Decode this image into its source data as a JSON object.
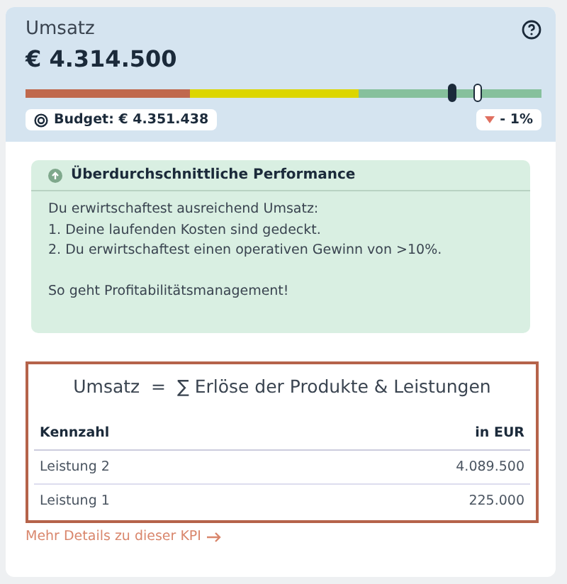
{
  "kpi": {
    "title": "Umsatz",
    "value": "€ 4.314.500",
    "actual_marker": {
      "level": 0.826
    },
    "budget_marker": {
      "level": 0.875
    },
    "budget": "Budget: € 4.351.438",
    "delta": {
      "text": "- 1%",
      "negative": true
    }
  },
  "assessment": {
    "title": "Überdurchschnittliche Performance",
    "paragraphs": [
      [
        "Du erwirtschaftest ausreichend Umsatz:",
        "1. Deine laufenden Kosten sind gedeckt.",
        "2. Du erwirtschaftest einen operativen Gewinn von >10%."
      ],
      [
        "So geht Profitabilitätsmanagement!"
      ]
    ]
  },
  "formula": "Umsatz  =  ∑ Erlöse der Produkte & Leistungen",
  "table": {
    "columns": [
      "Kennzahl",
      "in EUR"
    ],
    "rows": [
      {
        "cells": [
          "Leistung 2",
          "4.089.500"
        ]
      },
      {
        "cells": [
          "Leistung 1",
          "225.000"
        ]
      }
    ]
  },
  "link": "Mehr Details zu dieser KPI"
}
